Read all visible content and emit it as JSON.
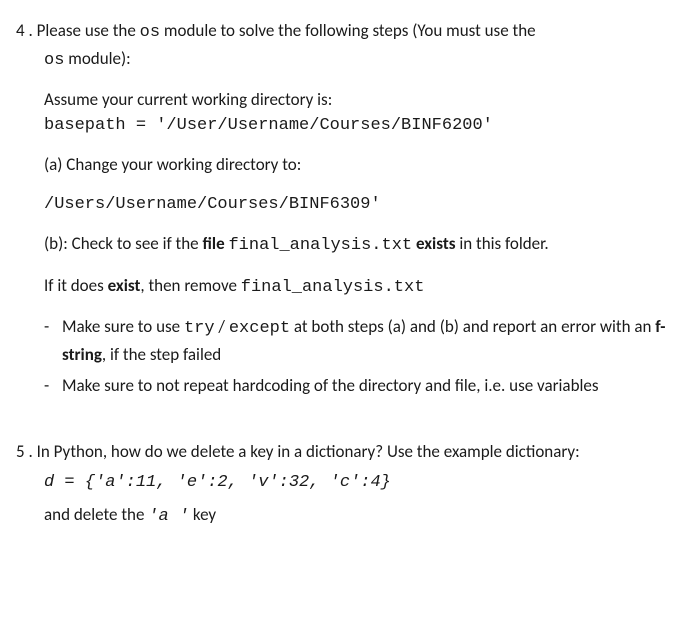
{
  "q4": {
    "number": "4 .",
    "intro_pre": " Please use the ",
    "intro_mod1": "os",
    "intro_mid": " module to solve the following steps (You must use the ",
    "intro_mod2": "os",
    "intro_post": " module):",
    "assume_label": "Assume your current working directory  is:",
    "basepath_code": "basepath = '/User/Username/Courses/BINF6200'",
    "part_a_label": "(a)  Change your working directory to:",
    "part_a_path": "/Users/Username/Courses/BINF6309'",
    "part_b_pre": "(b): Check to see if the ",
    "part_b_file_word": "file",
    "part_b_space1": "  ",
    "part_b_filename": "final_analysis.txt",
    "part_b_space2": " ",
    "part_b_exists": "exists",
    "part_b_post": " in this folder.",
    "if_exist_pre": "If it does ",
    "if_exist_bold": "exist",
    "if_exist_mid": ", then remove ",
    "if_exist_file": "final_analysis.txt",
    "bullet1_pre": "Make sure to use ",
    "bullet1_try": "try",
    "bullet1_slash": " / ",
    "bullet1_except": "except",
    "bullet1_mid": " at both steps (a) and (b) and report an error with an ",
    "bullet1_fstring": "f-string",
    "bullet1_post": ", if the step failed",
    "bullet2": "Make sure to not repeat hardcoding of the directory and file, i.e. use variables"
  },
  "q5": {
    "number": "5 .",
    "intro": " In Python, how do we delete a key in a dictionary? Use the example dictionary:",
    "dict_code": "d =  {'a':11, 'e':2, 'v':32, 'c':4}",
    "delete_pre": "and delete the ",
    "delete_key": " 'a '",
    "delete_post": " key"
  }
}
